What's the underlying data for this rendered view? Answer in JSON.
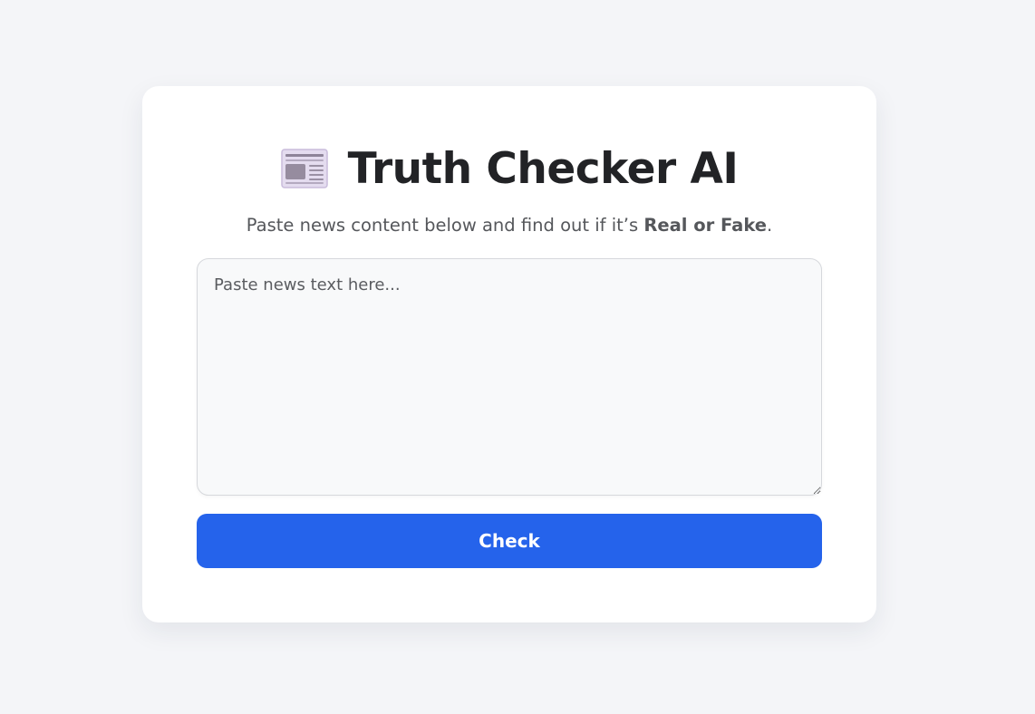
{
  "header": {
    "icon": "newspaper-icon",
    "title": "Truth Checker AI",
    "subtitle_prefix": "Paste news content below and find out if it’s ",
    "subtitle_emphasis": "Real or Fake",
    "subtitle_suffix": "."
  },
  "form": {
    "news_input": {
      "value": "",
      "placeholder": "Paste news text here..."
    },
    "check_label": "Check"
  },
  "colors": {
    "page_background": "#f4f5f8",
    "card_background": "#ffffff",
    "accent": "#2563eb",
    "title_text": "#222326"
  }
}
